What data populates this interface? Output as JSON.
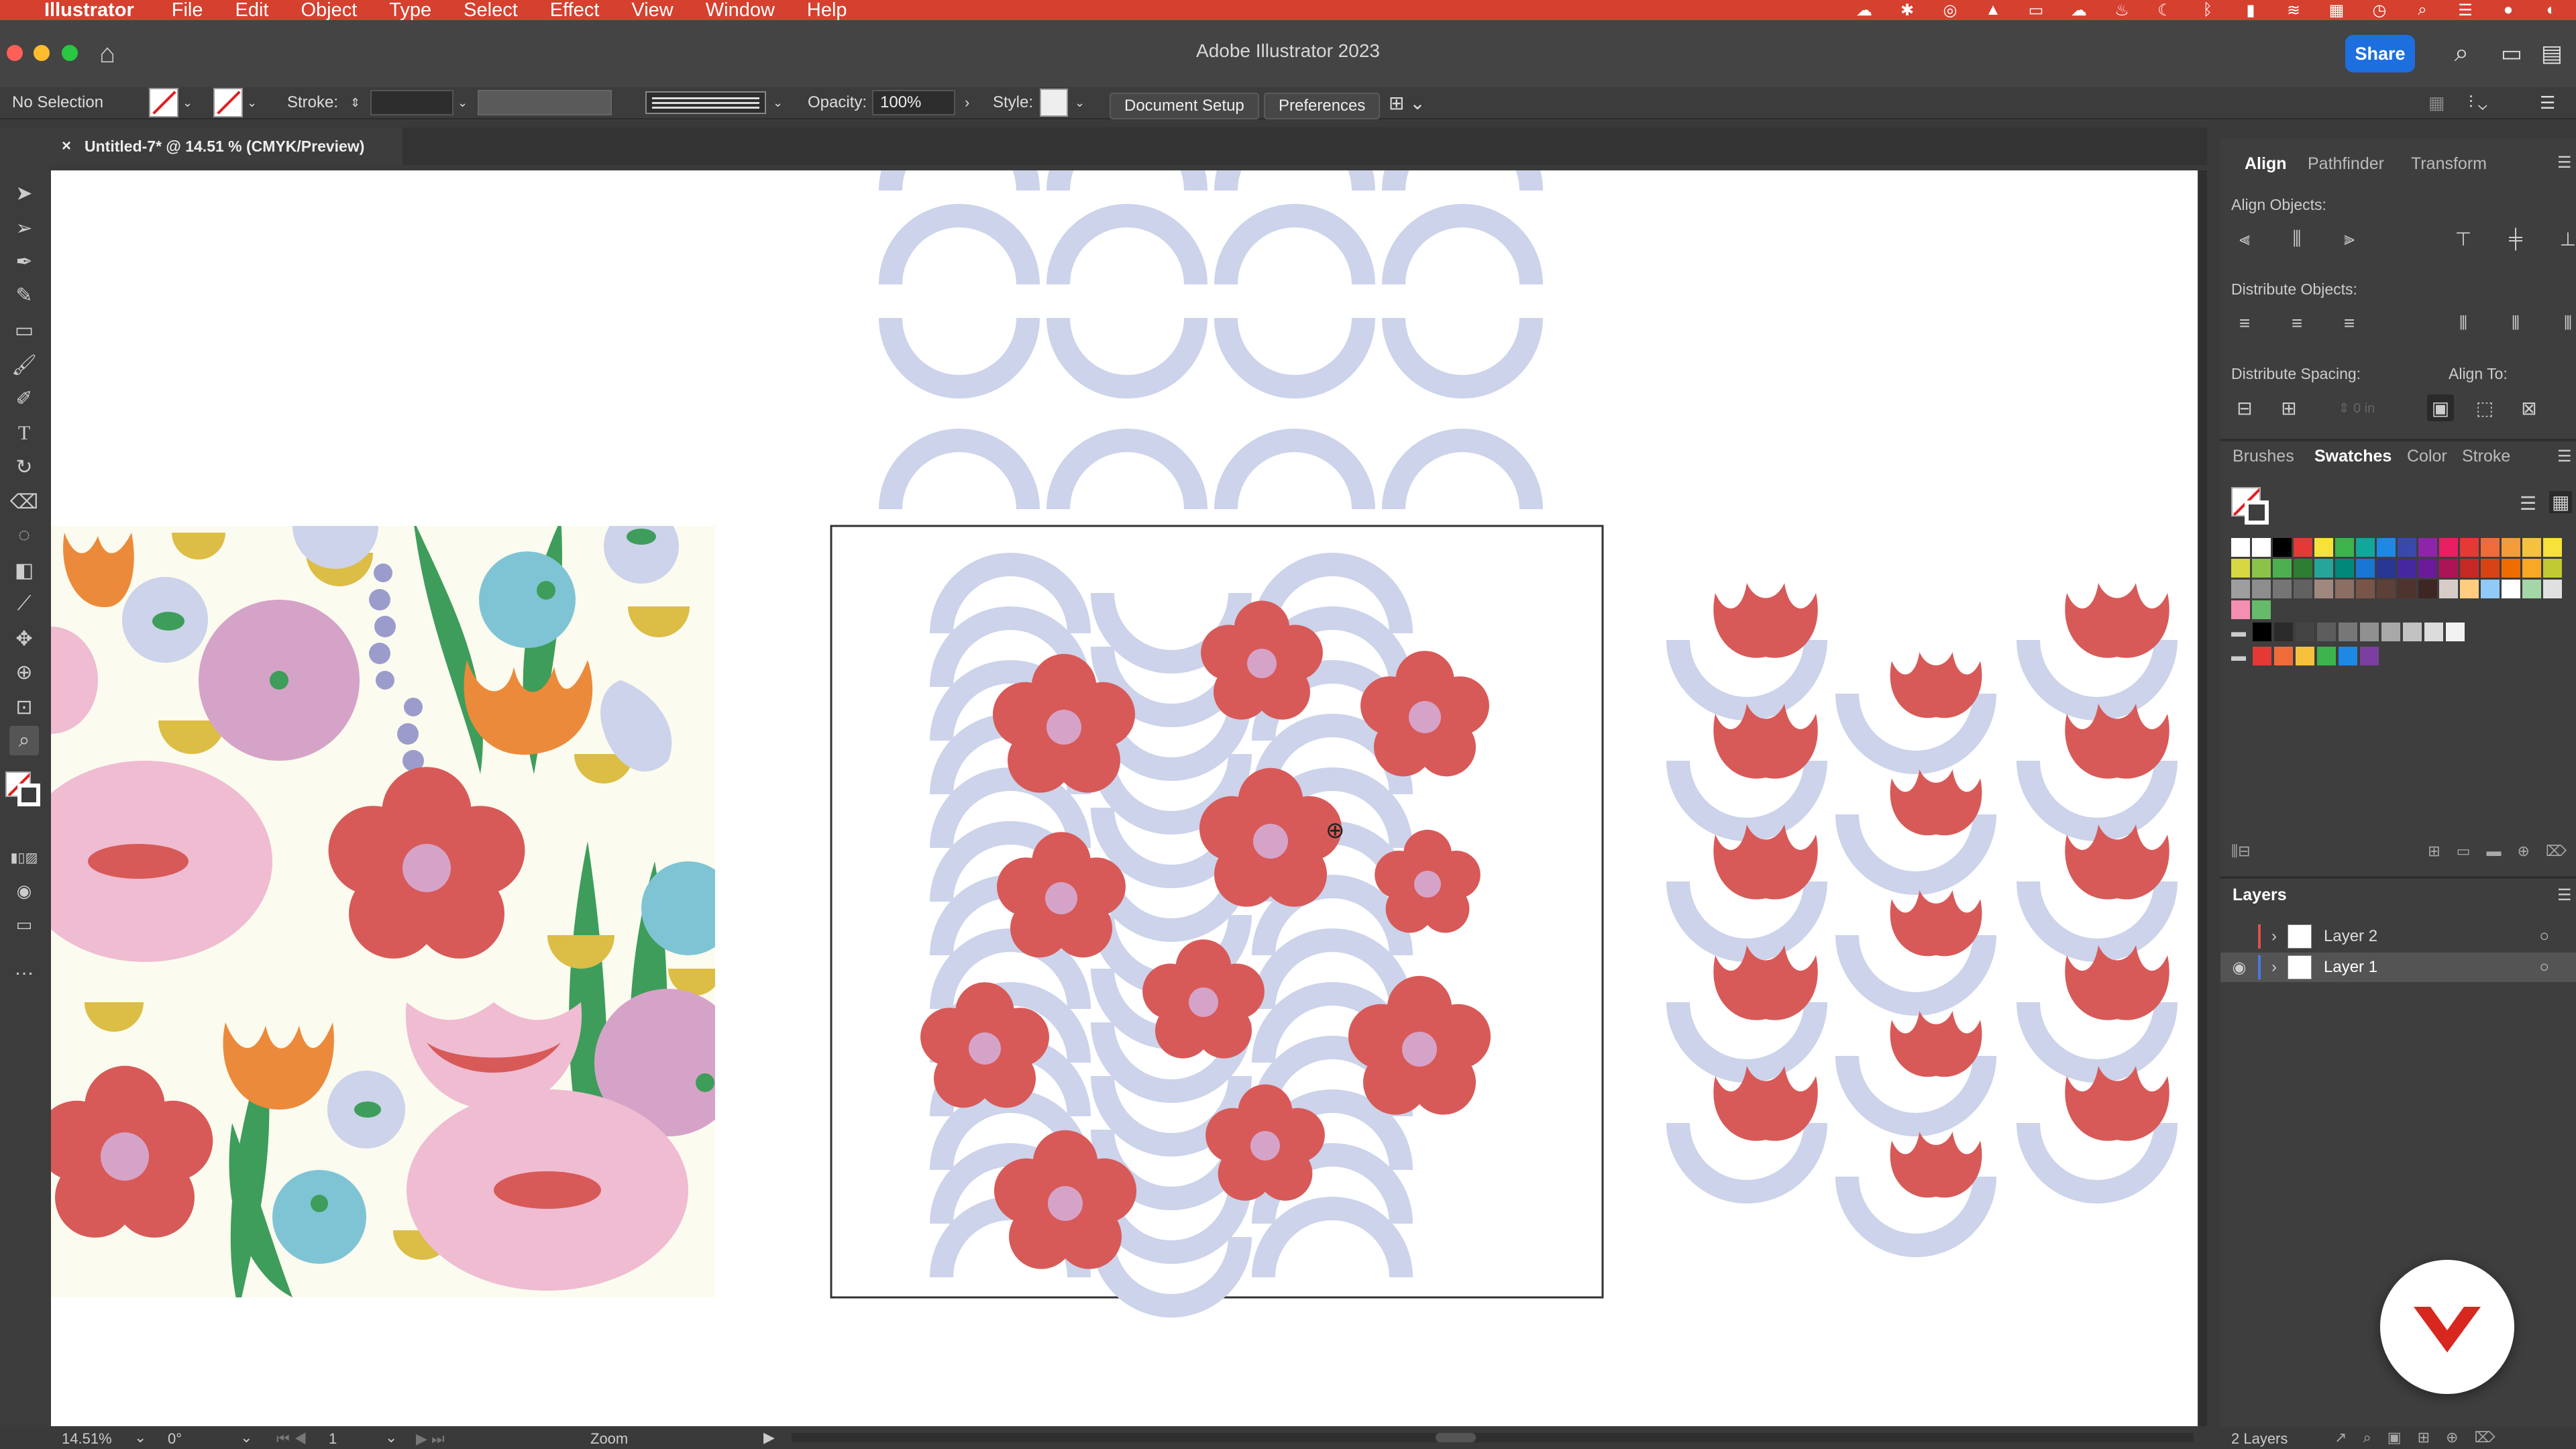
{
  "menubar": {
    "app": "Illustrator",
    "items": [
      "File",
      "Edit",
      "Object",
      "Type",
      "Select",
      "Effect",
      "View",
      "Window",
      "Help"
    ]
  },
  "window": {
    "title": "Adobe Illustrator 2023",
    "share_label": "Share"
  },
  "controlbar": {
    "selection": "No Selection",
    "stroke_label": "Stroke:",
    "opacity_label": "Opacity:",
    "opacity_value": "100%",
    "style_label": "Style:",
    "document_setup": "Document Setup",
    "preferences": "Preferences"
  },
  "document_tab": {
    "title": "Untitled-7* @ 14.51 % (CMYK/Preview)"
  },
  "panels": {
    "align_tabs": [
      "Align",
      "Pathfinder",
      "Transform"
    ],
    "align_objects_label": "Align Objects:",
    "distribute_objects_label": "Distribute Objects:",
    "distribute_spacing_label": "Distribute Spacing:",
    "align_to_label": "Align To:",
    "swatch_tabs": [
      "Brushes",
      "Swatches",
      "Color",
      "Stroke"
    ],
    "layers_title": "Layers",
    "layers": [
      {
        "name": "Layer 2",
        "color": "#e05050"
      },
      {
        "name": "Layer 1",
        "color": "#4a7ae0"
      }
    ]
  },
  "statusbar": {
    "zoom": "14.51%",
    "rotation": "0°",
    "artboard": "1",
    "tool": "Zoom",
    "layers_count": "2 Layers"
  },
  "colors": {
    "accent": "#d5402f",
    "share": "#1d6fe0",
    "flower_red": "#d75a58",
    "wave_blue": "#ccd3ea",
    "flower_center": "#d6a3c8"
  },
  "swatch_rows": [
    [
      "#ffffff",
      "#ffffff",
      "#000000",
      "#e53935",
      "#f7e13a",
      "#3cb44b",
      "#0fa89a",
      "#1e88e5",
      "#3949ab",
      "#8e24aa",
      "#e91e63",
      "#e53935",
      "#ef6c3a",
      "#f39c38",
      "#f6c23e",
      "#f7e13a"
    ],
    [
      "#d7d744",
      "#8bc34a",
      "#4caf50",
      "#2e7d32",
      "#26a69a",
      "#00897b",
      "#1976d2",
      "#283593",
      "#4527a0",
      "#6a1b9a",
      "#ad1457",
      "#c62828",
      "#d84315",
      "#ef6c00",
      "#f9a825",
      "#c0ca33"
    ],
    [
      "#9e9e9e",
      "#8d8d8d",
      "#757575",
      "#616161",
      "#a1887f",
      "#8d6e63",
      "#795548",
      "#5d4037",
      "#4e342e",
      "#3e2723",
      "#d7ccc8",
      "#ffcc80",
      "#90caf9",
      "#ffffff",
      "#a5d6a7",
      "#e0e0e0"
    ],
    [
      "#f48fb1",
      "#66bb6a"
    ]
  ]
}
